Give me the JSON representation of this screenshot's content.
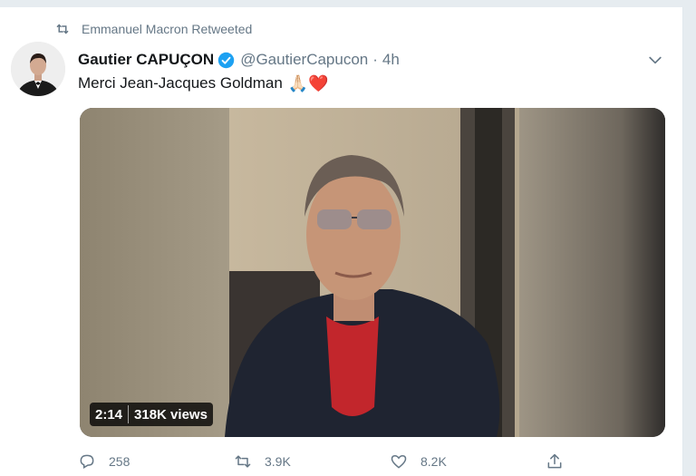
{
  "retweet": {
    "text": "Emmanuel Macron Retweeted",
    "icon": "retweet-icon"
  },
  "author": {
    "name": "Gautier CAPUÇON",
    "handle": "@GautierCapucon",
    "separator": "·",
    "time": "4h",
    "verified_icon": "verified-badge-icon"
  },
  "tweet": {
    "text": "Merci Jean-Jacques Goldman",
    "emoji": "🙏🏻❤️"
  },
  "media": {
    "duration": "2:14",
    "views": "318K views"
  },
  "actions": {
    "replies": "258",
    "retweets": "3.9K",
    "likes": "8.2K"
  },
  "colors": {
    "accent": "#1da1f2",
    "secondary_text": "#657786",
    "like": "#e0245e"
  }
}
